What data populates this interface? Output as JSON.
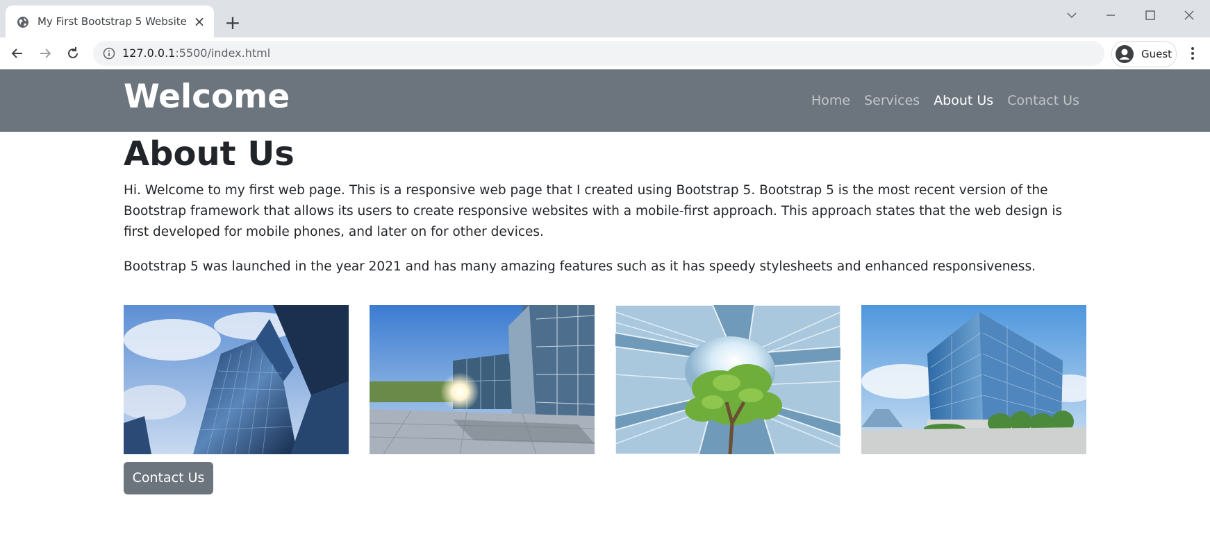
{
  "browser": {
    "tab_title": "My First Bootstrap 5 Website",
    "url_host": "127.0.0.1",
    "url_rest": ":5500/index.html",
    "profile_label": "Guest",
    "icons": [
      "globe-icon",
      "close-icon",
      "plus-icon",
      "chevron-down-icon",
      "minimize-icon",
      "maximize-icon",
      "window-close-icon",
      "back-icon",
      "forward-icon",
      "reload-icon",
      "info-icon",
      "profile-avatar-icon",
      "kebab-menu-icon"
    ]
  },
  "navbar": {
    "brand": "Welcome",
    "links": [
      {
        "label": "Home",
        "active": false
      },
      {
        "label": "Services",
        "active": false
      },
      {
        "label": "About Us",
        "active": true
      },
      {
        "label": "Contact Us",
        "active": false
      }
    ],
    "bg_color": "#6c757d"
  },
  "main": {
    "title": "About Us",
    "paragraph1": "Hi. Welcome to my first web page. This is a responsive web page that I created using Bootstrap 5. Bootstrap 5 is the most recent version of the Bootstrap framework that allows its users to create responsive websites with a mobile-first approach. This approach states that the web design is first developed for mobile phones, and later on for other devices.",
    "paragraph2": "Bootstrap 5 was launched in the year 2021 and has many amazing features such as it has speedy stylesheets and enhanced responsiveness.",
    "images": [
      "glass-skyscrapers-image",
      "office-plaza-image",
      "tree-among-towers-image",
      "glass-office-building-image"
    ],
    "contact_button": "Contact Us"
  }
}
